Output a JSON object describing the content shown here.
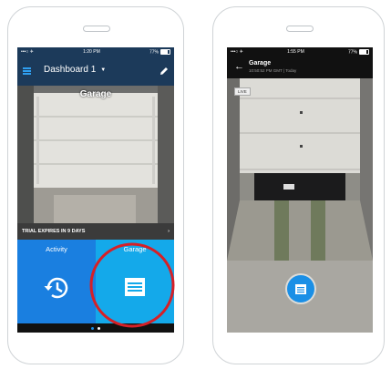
{
  "left": {
    "status": {
      "carrier": "•••○ ✈",
      "time": "1:20 PM",
      "battery": "77%"
    },
    "header": {
      "title": "Dashboard 1"
    },
    "camera": {
      "label": "Garage"
    },
    "trial": {
      "text": "TRIAL EXPIRES IN 9 DAYS",
      "arrow": "›"
    },
    "tiles": [
      {
        "label": "Activity",
        "icon": "history-icon",
        "color": "#1a7fe0"
      },
      {
        "label": "Garage",
        "icon": "garage-door-icon",
        "color": "#14a9ea"
      }
    ],
    "pager": {
      "count": 2,
      "active": 0
    }
  },
  "right": {
    "status": {
      "carrier": "•••○ ✈",
      "time": "1:55 PM",
      "battery": "77%"
    },
    "header": {
      "title": "Garage",
      "subtitle": "10:50:52 PM GMT | Today"
    },
    "live_badge": "LIVE",
    "button_icon": "garage-door-icon"
  },
  "colors": {
    "header_bg": "#1c3a5a",
    "accent": "#1a8fe6",
    "highlight_circle": "#d62027"
  }
}
